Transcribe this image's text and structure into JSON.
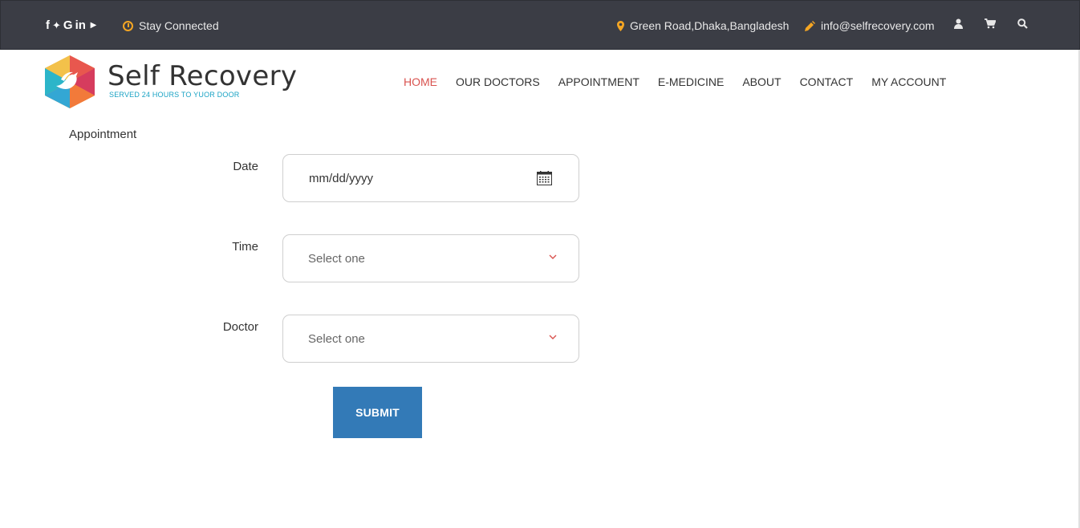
{
  "topbar": {
    "social_icons": [
      "facebook-icon",
      "twitter-icon",
      "google-icon",
      "linkedin-icon",
      "youtube-icon"
    ],
    "social_glyphs": {
      "facebook": "f",
      "twitter": "🐦",
      "google": "G",
      "linkedin": "in",
      "youtube": "You Tube"
    },
    "stay_connected": "Stay Connected",
    "address": "Green Road,Dhaka,Bangladesh",
    "email": "info@selfrecovery.com",
    "accent_color": "#f5a623",
    "background_color": "#3b3d45"
  },
  "header": {
    "brand": "Self Recovery",
    "tagline": "SERVED 24 HOURS TO YUOR DOOR",
    "nav": [
      {
        "label": "HOME",
        "active": true
      },
      {
        "label": "OUR DOCTORS",
        "active": false
      },
      {
        "label": "APPOINTMENT",
        "active": false
      },
      {
        "label": "E-MEDICINE",
        "active": false
      },
      {
        "label": "ABOUT",
        "active": false
      },
      {
        "label": "CONTACT",
        "active": false
      },
      {
        "label": "MY ACCOUNT",
        "active": false
      }
    ],
    "active_color": "#d9534f"
  },
  "form": {
    "title": "Appointment",
    "date": {
      "label": "Date",
      "placeholder": "mm/dd/yyyy"
    },
    "time": {
      "label": "Time",
      "value": "Select one"
    },
    "doctor": {
      "label": "Doctor",
      "value": "Select one"
    },
    "submit_label": "SUBMIT",
    "submit_color": "#337ab7"
  }
}
